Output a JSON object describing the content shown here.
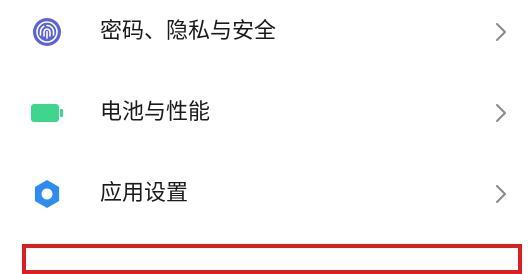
{
  "settings": {
    "items": [
      {
        "label": "密码、隐私与安全",
        "icon": "fingerprint-icon",
        "icon_color": "#5b63d6"
      },
      {
        "label": "电池与性能",
        "icon": "battery-icon",
        "icon_color": "#3dd68c"
      },
      {
        "label": "应用设置",
        "icon": "gear-icon",
        "icon_color": "#2e8bf0"
      }
    ]
  },
  "colors": {
    "highlight": "#d91f1f",
    "chevron": "#8a8a8a",
    "text": "#1a1a1a"
  }
}
